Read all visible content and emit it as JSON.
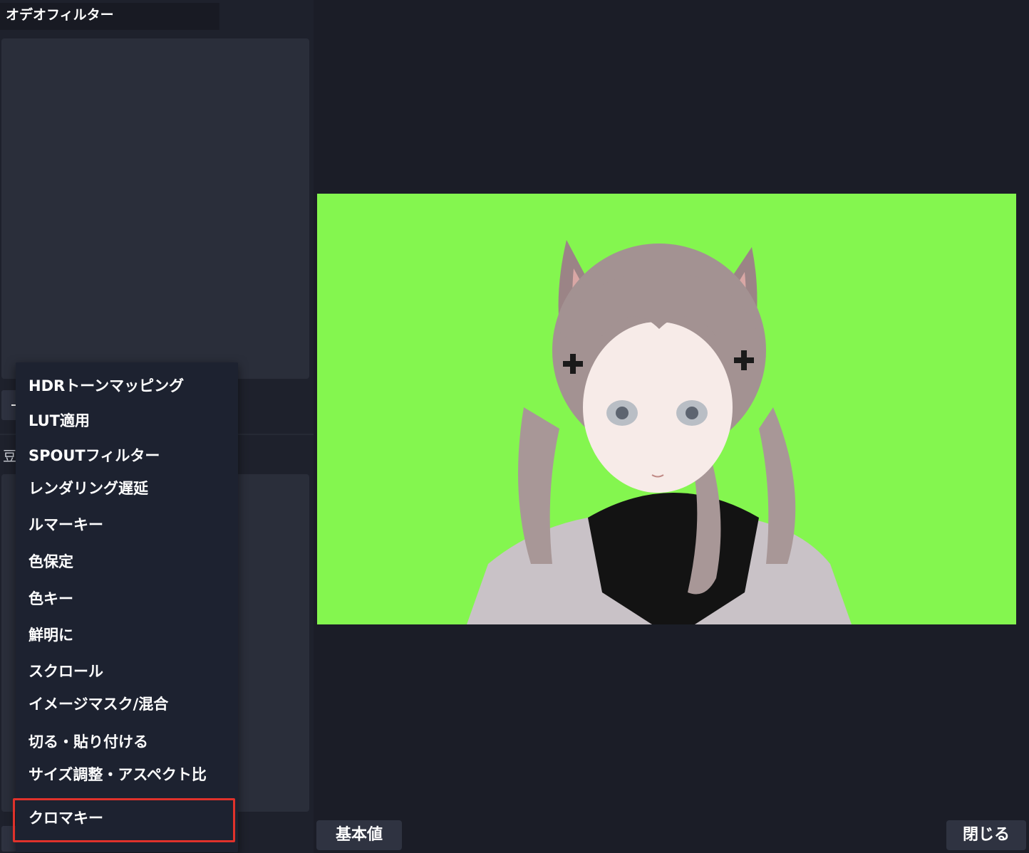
{
  "left_panel": {
    "section_title": "オデオフィルター",
    "effect_label": "豆"
  },
  "context_menu": {
    "items": [
      {
        "label": "HDRトーンマッピング"
      },
      {
        "label": "LUT適用"
      },
      {
        "label": "SPOUTフィルター"
      },
      {
        "label": "レンダリング遅延"
      },
      {
        "label": "ルマーキー"
      },
      {
        "label": "色保定"
      },
      {
        "label": "色キー"
      },
      {
        "label": "鮮明に"
      },
      {
        "label": "スクロール"
      },
      {
        "label": "イメージマスク/混合"
      },
      {
        "label": "切る・貼り付ける"
      },
      {
        "label": "サイズ調整・アスペクト比"
      },
      {
        "label": "クロマキー"
      }
    ],
    "highlighted_item": "クロマキー",
    "highlight_color": "#e0322b"
  },
  "preview": {
    "background_color": "#84f64f"
  },
  "footer": {
    "defaults_label": "基本値",
    "close_label": "閉じる"
  }
}
